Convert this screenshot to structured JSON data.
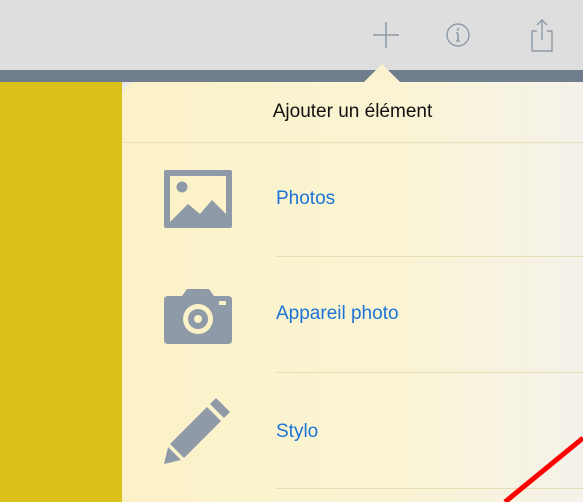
{
  "toolbar": {
    "icons": [
      {
        "name": "add-icon"
      },
      {
        "name": "info-icon"
      },
      {
        "name": "share-icon"
      }
    ]
  },
  "popover": {
    "title": "Ajouter un élément",
    "items": [
      {
        "label": "Photos",
        "icon": "photos-icon"
      },
      {
        "label": "Appareil photo",
        "icon": "camera-icon"
      },
      {
        "label": "Stylo",
        "icon": "pen-icon"
      }
    ]
  },
  "colors": {
    "accent_blue": "#1d74d8",
    "icon_gray": "#8e9aa8",
    "yellow_panel": "#dac21b",
    "annotation_red": "#ff0000"
  }
}
